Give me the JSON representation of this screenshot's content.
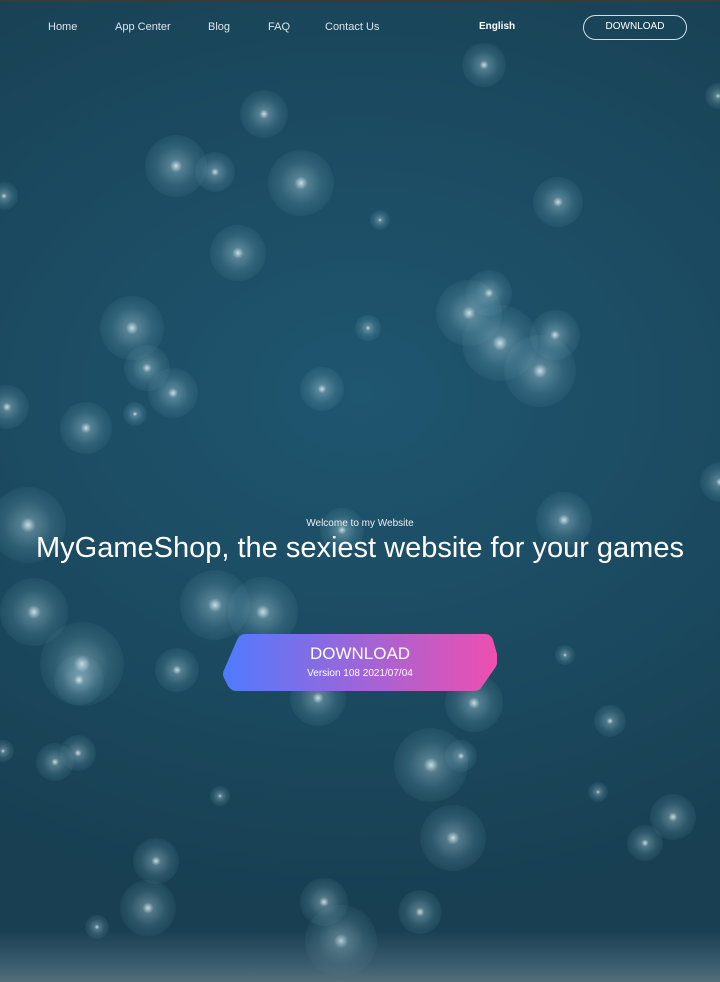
{
  "nav": {
    "links": [
      "Home",
      "App Center",
      "Blog",
      "FAQ",
      "Contact Us"
    ],
    "language": "English",
    "download_label": "DOWNLOAD"
  },
  "hero": {
    "welcome": "Welcome to my Website",
    "title": "MyGameShop, the sexiest website for your games",
    "cta_label": "DOWNLOAD",
    "cta_version": "Version 108  2021/07/04"
  },
  "colors": {
    "background": "#1d4a60",
    "cta_gradient_start": "#4f7bff",
    "cta_gradient_end": "#ee4fb0"
  }
}
